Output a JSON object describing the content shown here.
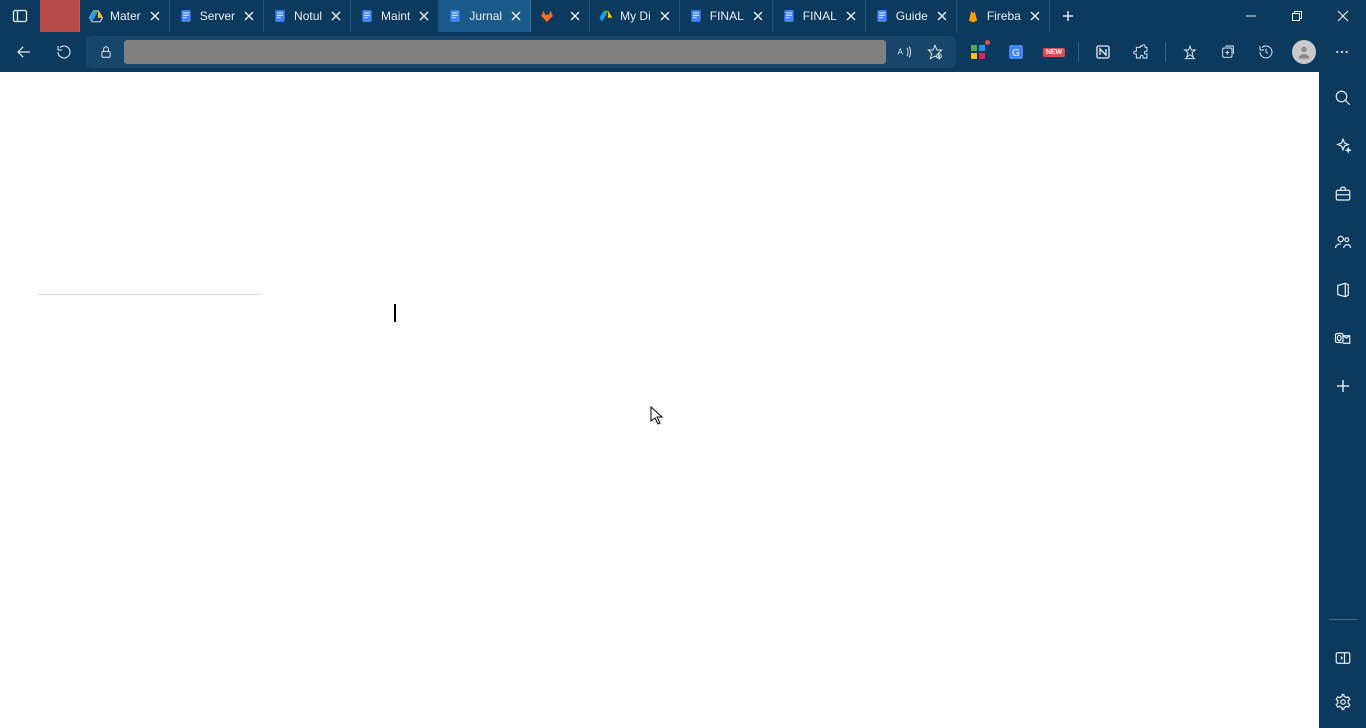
{
  "tabs": [
    {
      "label": "",
      "icon": "blank"
    },
    {
      "label": "Mater",
      "icon": "drive"
    },
    {
      "label": "Server",
      "icon": "docs"
    },
    {
      "label": "Notul",
      "icon": "docs"
    },
    {
      "label": "Maint",
      "icon": "docs"
    },
    {
      "label": "Jurnal",
      "icon": "docs",
      "active": true
    },
    {
      "label": "",
      "icon": "gitlab"
    },
    {
      "label": "My Di",
      "icon": "drive"
    },
    {
      "label": "FINAL",
      "icon": "docs"
    },
    {
      "label": "FINAL",
      "icon": "docs"
    },
    {
      "label": "Guide",
      "icon": "docs"
    },
    {
      "label": "Fireba",
      "icon": "firebase"
    }
  ],
  "address_bar": {
    "value": "",
    "placeholder": ""
  },
  "toolbar_icons": {
    "back": "←",
    "refresh": "⟳"
  },
  "right_tools": {
    "new_badge": "NEW"
  },
  "sidebar": {
    "items": [
      "search",
      "sparkle",
      "briefcase",
      "people",
      "office",
      "outlook",
      "plus"
    ],
    "bottom": [
      "panel",
      "settings"
    ]
  }
}
